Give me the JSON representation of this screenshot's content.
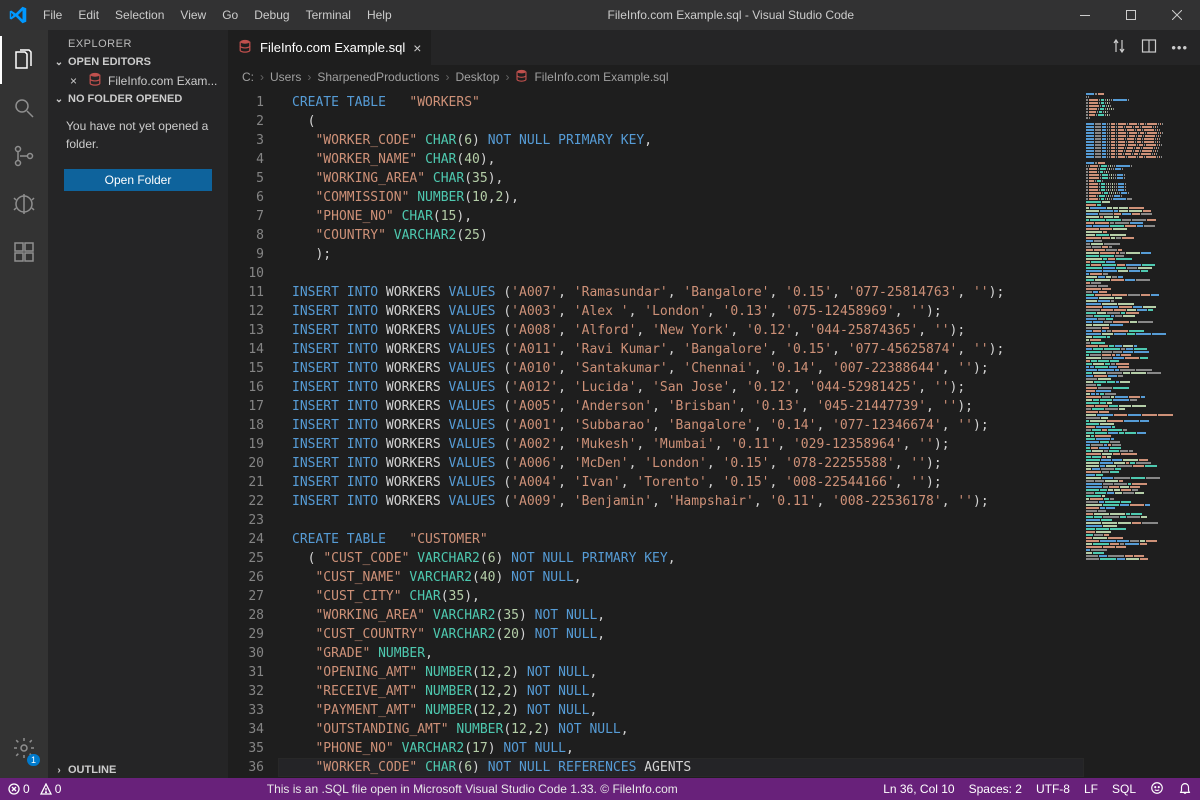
{
  "window": {
    "title": "FileInfo.com Example.sql - Visual Studio Code",
    "menu": [
      "File",
      "Edit",
      "Selection",
      "View",
      "Go",
      "Debug",
      "Terminal",
      "Help"
    ]
  },
  "activitybar": {
    "items": [
      {
        "name": "explorer",
        "active": true
      },
      {
        "name": "search"
      },
      {
        "name": "scm"
      },
      {
        "name": "debug"
      },
      {
        "name": "extensions"
      }
    ],
    "settings_badge": "1"
  },
  "sidebar": {
    "title": "EXPLORER",
    "open_editors_label": "OPEN EDITORS",
    "open_editor_item": "FileInfo.com Exam...",
    "no_folder_label": "NO FOLDER OPENED",
    "no_folder_msg": "You have not yet opened a folder.",
    "open_folder_btn": "Open Folder",
    "outline_label": "OUTLINE"
  },
  "tab": {
    "label": "FileInfo.com Example.sql"
  },
  "breadcrumbs": [
    "C:",
    "Users",
    "SharpenedProductions",
    "Desktop",
    "FileInfo.com Example.sql"
  ],
  "status": {
    "errors": "0",
    "warnings": "0",
    "center": "This is an .SQL file open in Microsoft Visual Studio Code 1.33. © FileInfo.com",
    "ln_col": "Ln 36, Col 10",
    "spaces": "Spaces: 2",
    "encoding": "UTF-8",
    "eol": "LF",
    "lang": "SQL"
  },
  "code": [
    [
      [
        "kw",
        "CREATE TABLE"
      ],
      [
        "id",
        "   "
      ],
      [
        "str",
        "\"WORKERS\""
      ]
    ],
    [
      [
        "id",
        "  "
      ],
      [
        "punc",
        "("
      ]
    ],
    [
      [
        "id",
        "   "
      ],
      [
        "str",
        "\"WORKER_CODE\""
      ],
      [
        "id",
        " "
      ],
      [
        "type",
        "CHAR"
      ],
      [
        "punc",
        "("
      ],
      [
        "num",
        "6"
      ],
      [
        "punc",
        ")"
      ],
      [
        "id",
        " "
      ],
      [
        "kw",
        "NOT NULL PRIMARY KEY"
      ],
      [
        "punc",
        ","
      ]
    ],
    [
      [
        "id",
        "   "
      ],
      [
        "str",
        "\"WORKER_NAME\""
      ],
      [
        "id",
        " "
      ],
      [
        "type",
        "CHAR"
      ],
      [
        "punc",
        "("
      ],
      [
        "num",
        "40"
      ],
      [
        "punc",
        "),"
      ]
    ],
    [
      [
        "id",
        "   "
      ],
      [
        "str",
        "\"WORKING_AREA\""
      ],
      [
        "id",
        " "
      ],
      [
        "type",
        "CHAR"
      ],
      [
        "punc",
        "("
      ],
      [
        "num",
        "35"
      ],
      [
        "punc",
        "),"
      ]
    ],
    [
      [
        "id",
        "   "
      ],
      [
        "str",
        "\"COMMISSION\""
      ],
      [
        "id",
        " "
      ],
      [
        "type",
        "NUMBER"
      ],
      [
        "punc",
        "("
      ],
      [
        "num",
        "10"
      ],
      [
        "punc",
        ","
      ],
      [
        "num",
        "2"
      ],
      [
        "punc",
        "),"
      ]
    ],
    [
      [
        "id",
        "   "
      ],
      [
        "str",
        "\"PHONE_NO\""
      ],
      [
        "id",
        " "
      ],
      [
        "type",
        "CHAR"
      ],
      [
        "punc",
        "("
      ],
      [
        "num",
        "15"
      ],
      [
        "punc",
        "),"
      ]
    ],
    [
      [
        "id",
        "   "
      ],
      [
        "str",
        "\"COUNTRY\""
      ],
      [
        "id",
        " "
      ],
      [
        "type",
        "VARCHAR2"
      ],
      [
        "punc",
        "("
      ],
      [
        "num",
        "25"
      ],
      [
        "punc",
        ")"
      ]
    ],
    [
      [
        "id",
        "   "
      ],
      [
        "punc",
        ");"
      ]
    ],
    [],
    [
      [
        "kw",
        "INSERT INTO"
      ],
      [
        "id",
        " WORKERS "
      ],
      [
        "kw",
        "VALUES"
      ],
      [
        "id",
        " "
      ],
      [
        "punc",
        "("
      ],
      [
        "str",
        "'A007'"
      ],
      [
        "punc",
        ", "
      ],
      [
        "str",
        "'Ramasundar'"
      ],
      [
        "punc",
        ", "
      ],
      [
        "str",
        "'Bangalore'"
      ],
      [
        "punc",
        ", "
      ],
      [
        "str",
        "'0.15'"
      ],
      [
        "punc",
        ", "
      ],
      [
        "str",
        "'077-25814763'"
      ],
      [
        "punc",
        ", "
      ],
      [
        "str",
        "''"
      ],
      [
        "punc",
        ");"
      ]
    ],
    [
      [
        "kw",
        "INSERT INTO"
      ],
      [
        "id",
        " WORKERS "
      ],
      [
        "kw",
        "VALUES"
      ],
      [
        "id",
        " "
      ],
      [
        "punc",
        "("
      ],
      [
        "str",
        "'A003'"
      ],
      [
        "punc",
        ", "
      ],
      [
        "str",
        "'Alex '"
      ],
      [
        "punc",
        ", "
      ],
      [
        "str",
        "'London'"
      ],
      [
        "punc",
        ", "
      ],
      [
        "str",
        "'0.13'"
      ],
      [
        "punc",
        ", "
      ],
      [
        "str",
        "'075-12458969'"
      ],
      [
        "punc",
        ", "
      ],
      [
        "str",
        "''"
      ],
      [
        "punc",
        ");"
      ]
    ],
    [
      [
        "kw",
        "INSERT INTO"
      ],
      [
        "id",
        " WORKERS "
      ],
      [
        "kw",
        "VALUES"
      ],
      [
        "id",
        " "
      ],
      [
        "punc",
        "("
      ],
      [
        "str",
        "'A008'"
      ],
      [
        "punc",
        ", "
      ],
      [
        "str",
        "'Alford'"
      ],
      [
        "punc",
        ", "
      ],
      [
        "str",
        "'New York'"
      ],
      [
        "punc",
        ", "
      ],
      [
        "str",
        "'0.12'"
      ],
      [
        "punc",
        ", "
      ],
      [
        "str",
        "'044-25874365'"
      ],
      [
        "punc",
        ", "
      ],
      [
        "str",
        "''"
      ],
      [
        "punc",
        ");"
      ]
    ],
    [
      [
        "kw",
        "INSERT INTO"
      ],
      [
        "id",
        " WORKERS "
      ],
      [
        "kw",
        "VALUES"
      ],
      [
        "id",
        " "
      ],
      [
        "punc",
        "("
      ],
      [
        "str",
        "'A011'"
      ],
      [
        "punc",
        ", "
      ],
      [
        "str",
        "'Ravi Kumar'"
      ],
      [
        "punc",
        ", "
      ],
      [
        "str",
        "'Bangalore'"
      ],
      [
        "punc",
        ", "
      ],
      [
        "str",
        "'0.15'"
      ],
      [
        "punc",
        ", "
      ],
      [
        "str",
        "'077-45625874'"
      ],
      [
        "punc",
        ", "
      ],
      [
        "str",
        "''"
      ],
      [
        "punc",
        ");"
      ]
    ],
    [
      [
        "kw",
        "INSERT INTO"
      ],
      [
        "id",
        " WORKERS "
      ],
      [
        "kw",
        "VALUES"
      ],
      [
        "id",
        " "
      ],
      [
        "punc",
        "("
      ],
      [
        "str",
        "'A010'"
      ],
      [
        "punc",
        ", "
      ],
      [
        "str",
        "'Santakumar'"
      ],
      [
        "punc",
        ", "
      ],
      [
        "str",
        "'Chennai'"
      ],
      [
        "punc",
        ", "
      ],
      [
        "str",
        "'0.14'"
      ],
      [
        "punc",
        ", "
      ],
      [
        "str",
        "'007-22388644'"
      ],
      [
        "punc",
        ", "
      ],
      [
        "str",
        "''"
      ],
      [
        "punc",
        ");"
      ]
    ],
    [
      [
        "kw",
        "INSERT INTO"
      ],
      [
        "id",
        " WORKERS "
      ],
      [
        "kw",
        "VALUES"
      ],
      [
        "id",
        " "
      ],
      [
        "punc",
        "("
      ],
      [
        "str",
        "'A012'"
      ],
      [
        "punc",
        ", "
      ],
      [
        "str",
        "'Lucida'"
      ],
      [
        "punc",
        ", "
      ],
      [
        "str",
        "'San Jose'"
      ],
      [
        "punc",
        ", "
      ],
      [
        "str",
        "'0.12'"
      ],
      [
        "punc",
        ", "
      ],
      [
        "str",
        "'044-52981425'"
      ],
      [
        "punc",
        ", "
      ],
      [
        "str",
        "''"
      ],
      [
        "punc",
        ");"
      ]
    ],
    [
      [
        "kw",
        "INSERT INTO"
      ],
      [
        "id",
        " WORKERS "
      ],
      [
        "kw",
        "VALUES"
      ],
      [
        "id",
        " "
      ],
      [
        "punc",
        "("
      ],
      [
        "str",
        "'A005'"
      ],
      [
        "punc",
        ", "
      ],
      [
        "str",
        "'Anderson'"
      ],
      [
        "punc",
        ", "
      ],
      [
        "str",
        "'Brisban'"
      ],
      [
        "punc",
        ", "
      ],
      [
        "str",
        "'0.13'"
      ],
      [
        "punc",
        ", "
      ],
      [
        "str",
        "'045-21447739'"
      ],
      [
        "punc",
        ", "
      ],
      [
        "str",
        "''"
      ],
      [
        "punc",
        ");"
      ]
    ],
    [
      [
        "kw",
        "INSERT INTO"
      ],
      [
        "id",
        " WORKERS "
      ],
      [
        "kw",
        "VALUES"
      ],
      [
        "id",
        " "
      ],
      [
        "punc",
        "("
      ],
      [
        "str",
        "'A001'"
      ],
      [
        "punc",
        ", "
      ],
      [
        "str",
        "'Subbarao'"
      ],
      [
        "punc",
        ", "
      ],
      [
        "str",
        "'Bangalore'"
      ],
      [
        "punc",
        ", "
      ],
      [
        "str",
        "'0.14'"
      ],
      [
        "punc",
        ", "
      ],
      [
        "str",
        "'077-12346674'"
      ],
      [
        "punc",
        ", "
      ],
      [
        "str",
        "''"
      ],
      [
        "punc",
        ");"
      ]
    ],
    [
      [
        "kw",
        "INSERT INTO"
      ],
      [
        "id",
        " WORKERS "
      ],
      [
        "kw",
        "VALUES"
      ],
      [
        "id",
        " "
      ],
      [
        "punc",
        "("
      ],
      [
        "str",
        "'A002'"
      ],
      [
        "punc",
        ", "
      ],
      [
        "str",
        "'Mukesh'"
      ],
      [
        "punc",
        ", "
      ],
      [
        "str",
        "'Mumbai'"
      ],
      [
        "punc",
        ", "
      ],
      [
        "str",
        "'0.11'"
      ],
      [
        "punc",
        ", "
      ],
      [
        "str",
        "'029-12358964'"
      ],
      [
        "punc",
        ", "
      ],
      [
        "str",
        "''"
      ],
      [
        "punc",
        ");"
      ]
    ],
    [
      [
        "kw",
        "INSERT INTO"
      ],
      [
        "id",
        " WORKERS "
      ],
      [
        "kw",
        "VALUES"
      ],
      [
        "id",
        " "
      ],
      [
        "punc",
        "("
      ],
      [
        "str",
        "'A006'"
      ],
      [
        "punc",
        ", "
      ],
      [
        "str",
        "'McDen'"
      ],
      [
        "punc",
        ", "
      ],
      [
        "str",
        "'London'"
      ],
      [
        "punc",
        ", "
      ],
      [
        "str",
        "'0.15'"
      ],
      [
        "punc",
        ", "
      ],
      [
        "str",
        "'078-22255588'"
      ],
      [
        "punc",
        ", "
      ],
      [
        "str",
        "''"
      ],
      [
        "punc",
        ");"
      ]
    ],
    [
      [
        "kw",
        "INSERT INTO"
      ],
      [
        "id",
        " WORKERS "
      ],
      [
        "kw",
        "VALUES"
      ],
      [
        "id",
        " "
      ],
      [
        "punc",
        "("
      ],
      [
        "str",
        "'A004'"
      ],
      [
        "punc",
        ", "
      ],
      [
        "str",
        "'Ivan'"
      ],
      [
        "punc",
        ", "
      ],
      [
        "str",
        "'Torento'"
      ],
      [
        "punc",
        ", "
      ],
      [
        "str",
        "'0.15'"
      ],
      [
        "punc",
        ", "
      ],
      [
        "str",
        "'008-22544166'"
      ],
      [
        "punc",
        ", "
      ],
      [
        "str",
        "''"
      ],
      [
        "punc",
        ");"
      ]
    ],
    [
      [
        "kw",
        "INSERT INTO"
      ],
      [
        "id",
        " WORKERS "
      ],
      [
        "kw",
        "VALUES"
      ],
      [
        "id",
        " "
      ],
      [
        "punc",
        "("
      ],
      [
        "str",
        "'A009'"
      ],
      [
        "punc",
        ", "
      ],
      [
        "str",
        "'Benjamin'"
      ],
      [
        "punc",
        ", "
      ],
      [
        "str",
        "'Hampshair'"
      ],
      [
        "punc",
        ", "
      ],
      [
        "str",
        "'0.11'"
      ],
      [
        "punc",
        ", "
      ],
      [
        "str",
        "'008-22536178'"
      ],
      [
        "punc",
        ", "
      ],
      [
        "str",
        "''"
      ],
      [
        "punc",
        ");"
      ]
    ],
    [],
    [
      [
        "kw",
        "CREATE TABLE"
      ],
      [
        "id",
        "   "
      ],
      [
        "str",
        "\"CUSTOMER\""
      ]
    ],
    [
      [
        "id",
        "  "
      ],
      [
        "punc",
        "( "
      ],
      [
        "str",
        "\"CUST_CODE\""
      ],
      [
        "id",
        " "
      ],
      [
        "type",
        "VARCHAR2"
      ],
      [
        "punc",
        "("
      ],
      [
        "num",
        "6"
      ],
      [
        "punc",
        ")"
      ],
      [
        "id",
        " "
      ],
      [
        "kw",
        "NOT NULL PRIMARY KEY"
      ],
      [
        "punc",
        ","
      ]
    ],
    [
      [
        "id",
        "   "
      ],
      [
        "str",
        "\"CUST_NAME\""
      ],
      [
        "id",
        " "
      ],
      [
        "type",
        "VARCHAR2"
      ],
      [
        "punc",
        "("
      ],
      [
        "num",
        "40"
      ],
      [
        "punc",
        ")"
      ],
      [
        "id",
        " "
      ],
      [
        "kw",
        "NOT NULL"
      ],
      [
        "punc",
        ","
      ]
    ],
    [
      [
        "id",
        "   "
      ],
      [
        "str",
        "\"CUST_CITY\""
      ],
      [
        "id",
        " "
      ],
      [
        "type",
        "CHAR"
      ],
      [
        "punc",
        "("
      ],
      [
        "num",
        "35"
      ],
      [
        "punc",
        "),"
      ]
    ],
    [
      [
        "id",
        "   "
      ],
      [
        "str",
        "\"WORKING_AREA\""
      ],
      [
        "id",
        " "
      ],
      [
        "type",
        "VARCHAR2"
      ],
      [
        "punc",
        "("
      ],
      [
        "num",
        "35"
      ],
      [
        "punc",
        ")"
      ],
      [
        "id",
        " "
      ],
      [
        "kw",
        "NOT NULL"
      ],
      [
        "punc",
        ","
      ]
    ],
    [
      [
        "id",
        "   "
      ],
      [
        "str",
        "\"CUST_COUNTRY\""
      ],
      [
        "id",
        " "
      ],
      [
        "type",
        "VARCHAR2"
      ],
      [
        "punc",
        "("
      ],
      [
        "num",
        "20"
      ],
      [
        "punc",
        ")"
      ],
      [
        "id",
        " "
      ],
      [
        "kw",
        "NOT NULL"
      ],
      [
        "punc",
        ","
      ]
    ],
    [
      [
        "id",
        "   "
      ],
      [
        "str",
        "\"GRADE\""
      ],
      [
        "id",
        " "
      ],
      [
        "type",
        "NUMBER"
      ],
      [
        "punc",
        ","
      ]
    ],
    [
      [
        "id",
        "   "
      ],
      [
        "str",
        "\"OPENING_AMT\""
      ],
      [
        "id",
        " "
      ],
      [
        "type",
        "NUMBER"
      ],
      [
        "punc",
        "("
      ],
      [
        "num",
        "12"
      ],
      [
        "punc",
        ","
      ],
      [
        "num",
        "2"
      ],
      [
        "punc",
        ")"
      ],
      [
        "id",
        " "
      ],
      [
        "kw",
        "NOT NULL"
      ],
      [
        "punc",
        ","
      ]
    ],
    [
      [
        "id",
        "   "
      ],
      [
        "str",
        "\"RECEIVE_AMT\""
      ],
      [
        "id",
        " "
      ],
      [
        "type",
        "NUMBER"
      ],
      [
        "punc",
        "("
      ],
      [
        "num",
        "12"
      ],
      [
        "punc",
        ","
      ],
      [
        "num",
        "2"
      ],
      [
        "punc",
        ")"
      ],
      [
        "id",
        " "
      ],
      [
        "kw",
        "NOT NULL"
      ],
      [
        "punc",
        ","
      ]
    ],
    [
      [
        "id",
        "   "
      ],
      [
        "str",
        "\"PAYMENT_AMT\""
      ],
      [
        "id",
        " "
      ],
      [
        "type",
        "NUMBER"
      ],
      [
        "punc",
        "("
      ],
      [
        "num",
        "12"
      ],
      [
        "punc",
        ","
      ],
      [
        "num",
        "2"
      ],
      [
        "punc",
        ")"
      ],
      [
        "id",
        " "
      ],
      [
        "kw",
        "NOT NULL"
      ],
      [
        "punc",
        ","
      ]
    ],
    [
      [
        "id",
        "   "
      ],
      [
        "str",
        "\"OUTSTANDING_AMT\""
      ],
      [
        "id",
        " "
      ],
      [
        "type",
        "NUMBER"
      ],
      [
        "punc",
        "("
      ],
      [
        "num",
        "12"
      ],
      [
        "punc",
        ","
      ],
      [
        "num",
        "2"
      ],
      [
        "punc",
        ")"
      ],
      [
        "id",
        " "
      ],
      [
        "kw",
        "NOT NULL"
      ],
      [
        "punc",
        ","
      ]
    ],
    [
      [
        "id",
        "   "
      ],
      [
        "str",
        "\"PHONE_NO\""
      ],
      [
        "id",
        " "
      ],
      [
        "type",
        "VARCHAR2"
      ],
      [
        "punc",
        "("
      ],
      [
        "num",
        "17"
      ],
      [
        "punc",
        ")"
      ],
      [
        "id",
        " "
      ],
      [
        "kw",
        "NOT NULL"
      ],
      [
        "punc",
        ","
      ]
    ],
    [
      [
        "id",
        "   "
      ],
      [
        "str",
        "\"WORKER_CODE\""
      ],
      [
        "id",
        " "
      ],
      [
        "type",
        "CHAR"
      ],
      [
        "punc",
        "("
      ],
      [
        "num",
        "6"
      ],
      [
        "punc",
        ")"
      ],
      [
        "id",
        " "
      ],
      [
        "kw",
        "NOT NULL REFERENCES"
      ],
      [
        "id",
        " AGENTS"
      ]
    ]
  ]
}
